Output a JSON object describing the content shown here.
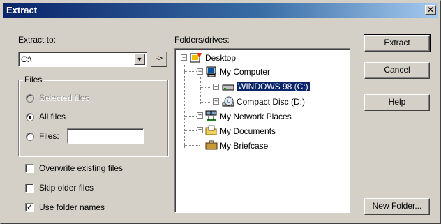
{
  "window": {
    "title": "Extract",
    "close_label": "✕"
  },
  "extract_to": {
    "label": "Extract to:",
    "value": "C:\\",
    "browse_label": "->"
  },
  "files_group": {
    "title": "Files",
    "options": [
      {
        "label": "Selected files",
        "selected": false,
        "disabled": true
      },
      {
        "label": "All files",
        "selected": true,
        "disabled": false
      },
      {
        "label": "Files:",
        "selected": false,
        "disabled": false
      }
    ],
    "files_value": ""
  },
  "checkboxes": [
    {
      "label": "Overwrite existing files",
      "checked": false
    },
    {
      "label": "Skip older files",
      "checked": false
    },
    {
      "label": "Use folder names",
      "checked": true
    }
  ],
  "folders": {
    "label": "Folders/drives:",
    "nodes": [
      {
        "label": "Desktop",
        "icon": "desktop-icon",
        "selected": false
      },
      {
        "label": "My Computer",
        "icon": "computer-icon",
        "selected": false
      },
      {
        "label": "WINDOWS 98 (C:)",
        "icon": "hard-drive-icon",
        "selected": true
      },
      {
        "label": "Compact Disc (D:)",
        "icon": "cd-drive-icon",
        "selected": false
      },
      {
        "label": "My Network Places",
        "icon": "network-icon",
        "selected": false
      },
      {
        "label": "My Documents",
        "icon": "documents-folder-icon",
        "selected": false
      },
      {
        "label": "My Briefcase",
        "icon": "briefcase-icon",
        "selected": false
      }
    ]
  },
  "buttons": {
    "extract": "Extract",
    "cancel": "Cancel",
    "help": "Help",
    "new_folder": "New Folder..."
  }
}
